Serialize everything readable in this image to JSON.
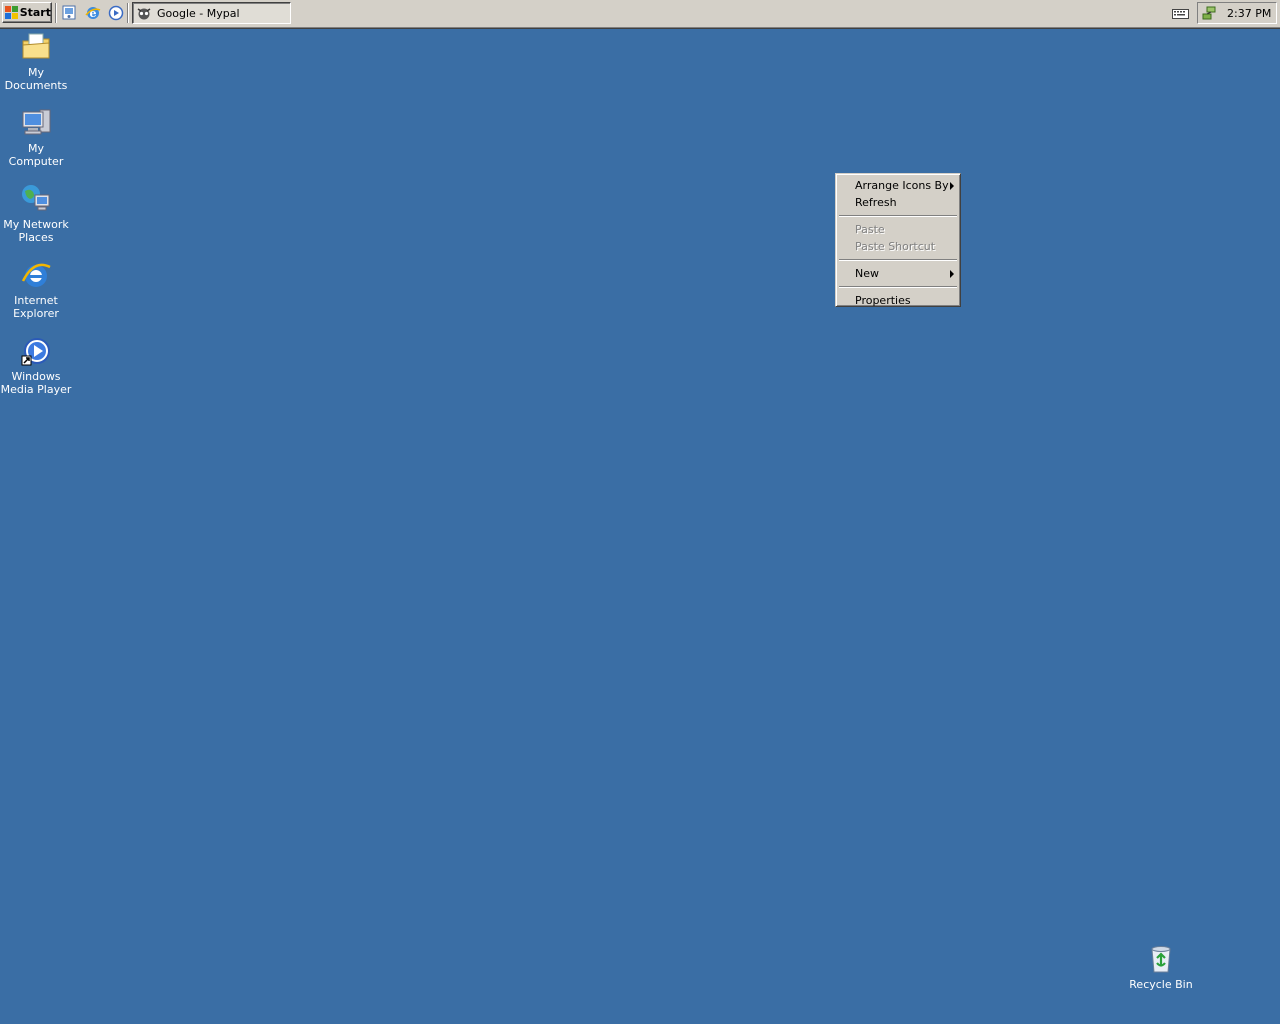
{
  "taskbar": {
    "start_label": "Start",
    "quick_launch": [
      {
        "icon": "show-desktop-icon"
      },
      {
        "icon": "internet-explorer-icon"
      },
      {
        "icon": "windows-media-player-icon"
      }
    ],
    "task_button_label": "Google - Mypal",
    "clock": "2:37 PM"
  },
  "desktop": {
    "background_color": "#3a6ea5",
    "icons": [
      {
        "label": "My Documents",
        "icon": "my-documents-icon"
      },
      {
        "label": "My Computer",
        "icon": "my-computer-icon"
      },
      {
        "label": "My Network Places",
        "icon": "my-network-places-icon"
      },
      {
        "label": "Internet Explorer",
        "icon": "internet-explorer-icon"
      },
      {
        "label": "Windows Media Player",
        "icon": "windows-media-player-icon"
      },
      {
        "label": "Recycle Bin",
        "icon": "recycle-bin-icon"
      }
    ]
  },
  "context_menu": {
    "items": [
      {
        "label": "Arrange Icons By",
        "submenu": true,
        "enabled": true
      },
      {
        "label": "Refresh",
        "enabled": true
      },
      {
        "label": "Paste",
        "enabled": false
      },
      {
        "label": "Paste Shortcut",
        "enabled": false
      },
      {
        "label": "New",
        "submenu": true,
        "enabled": true
      },
      {
        "label": "Properties",
        "enabled": true
      }
    ]
  }
}
